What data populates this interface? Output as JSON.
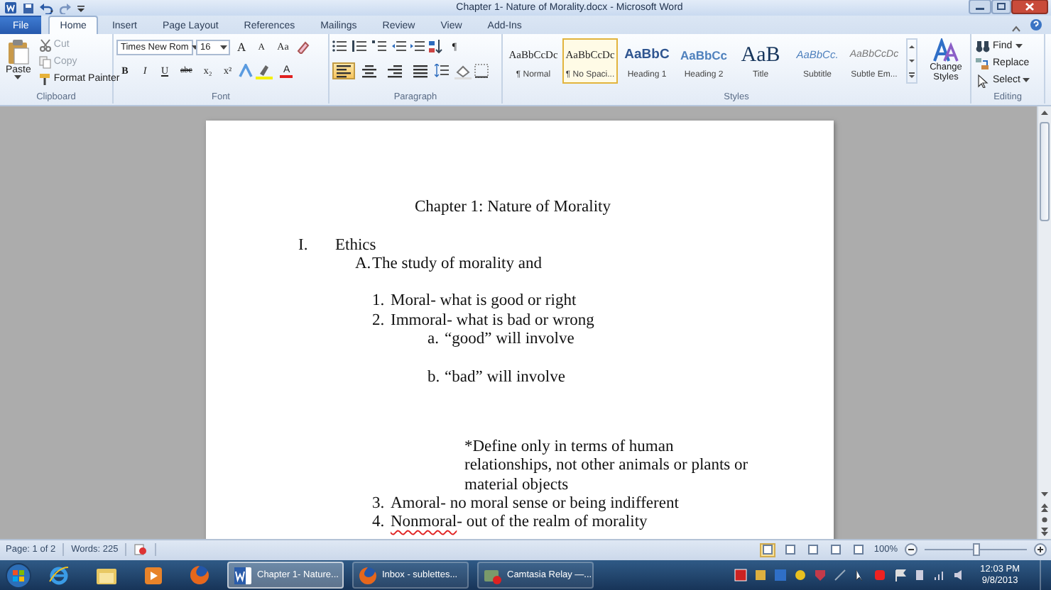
{
  "window": {
    "title": "Chapter 1- Nature of Morality.docx - Microsoft Word"
  },
  "tabs": [
    {
      "label": "File",
      "kind": "file",
      "selected": false
    },
    {
      "label": "Home",
      "kind": "tab",
      "selected": true
    },
    {
      "label": "Insert",
      "kind": "tab",
      "selected": false
    },
    {
      "label": "Page Layout",
      "kind": "tab",
      "selected": false
    },
    {
      "label": "References",
      "kind": "tab",
      "selected": false
    },
    {
      "label": "Mailings",
      "kind": "tab",
      "selected": false
    },
    {
      "label": "Review",
      "kind": "tab",
      "selected": false
    },
    {
      "label": "View",
      "kind": "tab",
      "selected": false
    },
    {
      "label": "Add-Ins",
      "kind": "tab",
      "selected": false
    }
  ],
  "ribbon": {
    "clipboard": {
      "label": "Clipboard",
      "paste": "Paste",
      "items": [
        {
          "label": "Cut",
          "kind": "cut",
          "disabled": true
        },
        {
          "label": "Copy",
          "kind": "copy",
          "disabled": true
        },
        {
          "label": "Format Painter",
          "kind": "painter",
          "disabled": false
        }
      ]
    },
    "font": {
      "label": "Font",
      "font_name": "Times New Rom",
      "font_size": "16",
      "size_buttons": [
        {
          "label": "A",
          "kind": "grow"
        },
        {
          "label": "A",
          "kind": "shrink"
        },
        {
          "label": "Aa",
          "kind": "case"
        }
      ],
      "format_buttons": [
        {
          "label": "B",
          "kind": "bold"
        },
        {
          "label": "I",
          "kind": "italic"
        },
        {
          "label": "U",
          "kind": "underline"
        },
        {
          "label": "abc",
          "kind": "strike"
        },
        {
          "label": "x₂",
          "kind": "sub"
        },
        {
          "label": "x²",
          "kind": "super"
        }
      ],
      "font_color": "A"
    },
    "paragraph": {
      "label": "Paragraph",
      "pilcrow": "¶",
      "alignment": [
        {
          "selected": true
        },
        {
          "selected": false
        },
        {
          "selected": false
        },
        {
          "selected": false
        }
      ]
    },
    "styles": {
      "label": "Styles",
      "items": [
        {
          "preview": "AaBbCcDc",
          "name": "¶ Normal",
          "kind": "normal",
          "selected": false
        },
        {
          "preview": "AaBbCcDc",
          "name": "¶ No Spaci...",
          "kind": "normal",
          "selected": true
        },
        {
          "preview": "AaBbC",
          "name": "Heading 1",
          "kind": "heading1",
          "selected": false
        },
        {
          "preview": "AaBbCc",
          "name": "Heading 2",
          "kind": "heading2",
          "selected": false
        },
        {
          "preview": "AaB",
          "name": "Title",
          "kind": "title",
          "selected": false
        },
        {
          "preview": "AaBbCc.",
          "name": "Subtitle",
          "kind": "subtitle",
          "selected": false
        },
        {
          "preview": "AaBbCcDc",
          "name": "Subtle Em...",
          "kind": "emphasis",
          "selected": false
        }
      ],
      "change_styles": "Change Styles"
    },
    "editing": {
      "label": "Editing",
      "items": [
        {
          "label": "Find",
          "kind": "find"
        },
        {
          "label": "Replace",
          "kind": "replace"
        },
        {
          "label": "Select",
          "kind": "select"
        }
      ]
    }
  },
  "document": {
    "title": "Chapter 1: Nature of Morality",
    "outline": [
      {
        "marker": "I.",
        "text": "Ethics",
        "children": [
          {
            "marker": "A.",
            "text": "The study of morality and",
            "children": [
              {
                "marker": "1.",
                "text": "Moral- what is good or right",
                "gap_before": true
              },
              {
                "marker": "2.",
                "text": "Immoral- what is bad or wrong",
                "children": [
                  {
                    "marker": "a.",
                    "text": "“good” will involve"
                  },
                  {
                    "marker": "b.",
                    "text": "“bad” will involve",
                    "gap_before": true,
                    "children": [
                      {
                        "kind": "note",
                        "text": "*Define only in terms of human relationships, not other animals or plants or material objects",
                        "gap_before": true
                      }
                    ]
                  }
                ]
              },
              {
                "marker": "3.",
                "text": "Amoral- no moral sense or being indifferent"
              },
              {
                "marker": "4.",
                "term": "Nonmoral",
                "misspelled": true,
                "text": "- out of the realm of morality"
              }
            ]
          }
        ]
      }
    ]
  },
  "status_bar": {
    "page": "Page: 1 of 2",
    "words": "Words: 225",
    "views": [
      {
        "selected": true
      },
      {
        "selected": false
      },
      {
        "selected": false
      },
      {
        "selected": false
      },
      {
        "selected": false
      }
    ],
    "zoom": "100%",
    "zoom_slider": {
      "level": 0.5
    }
  },
  "taskbar": {
    "tasks": [
      {
        "label": "Chapter 1- Nature...",
        "kind": "word",
        "selected": true
      },
      {
        "label": "Inbox - sublettes...",
        "kind": "firefox",
        "selected": false
      },
      {
        "label": "Camtasia Relay —...",
        "kind": "camtasia",
        "selected": false
      }
    ],
    "time": "12:03 PM",
    "date": "9/8/2013"
  }
}
